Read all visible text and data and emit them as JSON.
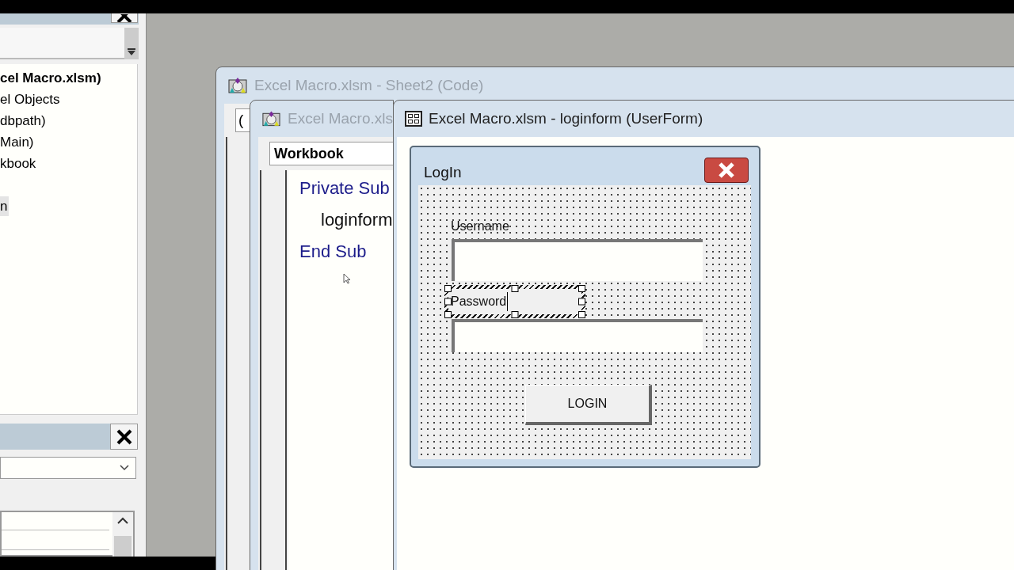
{
  "project_explorer": {
    "items": [
      {
        "label": "cel Macro.xlsm)",
        "bold": true,
        "selected": false
      },
      {
        "label": "el Objects",
        "bold": false,
        "selected": false
      },
      {
        "label": "dbpath)",
        "bold": false,
        "selected": false
      },
      {
        "label": "Main)",
        "bold": false,
        "selected": false
      },
      {
        "label": "kbook",
        "bold": false,
        "selected": false
      },
      {
        "label": "n",
        "bold": false,
        "selected": true
      }
    ]
  },
  "windows": [
    {
      "kind": "code",
      "title": "Excel Macro.xlsm - Sheet2 (Code)",
      "active": false,
      "object_box": "("
    },
    {
      "kind": "code",
      "title": "Excel Macro.xls",
      "active": false,
      "object_box": "Workbook",
      "code_lines": [
        {
          "kind": "keyword",
          "text": "Private Sub"
        },
        {
          "kind": "statement",
          "text": "loginform"
        },
        {
          "kind": "keyword",
          "text": "End Sub"
        }
      ]
    },
    {
      "kind": "userform",
      "title": "Excel Macro.xlsm - loginform (UserForm)",
      "active": true,
      "form": {
        "title": "LogIn",
        "controls": [
          {
            "kind": "label",
            "text": "Username",
            "selected": false
          },
          {
            "kind": "textbox",
            "selected": false
          },
          {
            "kind": "label",
            "text": "Password",
            "selected": true
          },
          {
            "kind": "textbox",
            "selected": false
          },
          {
            "kind": "button",
            "text": "LOGIN",
            "selected": false
          }
        ]
      }
    }
  ]
}
